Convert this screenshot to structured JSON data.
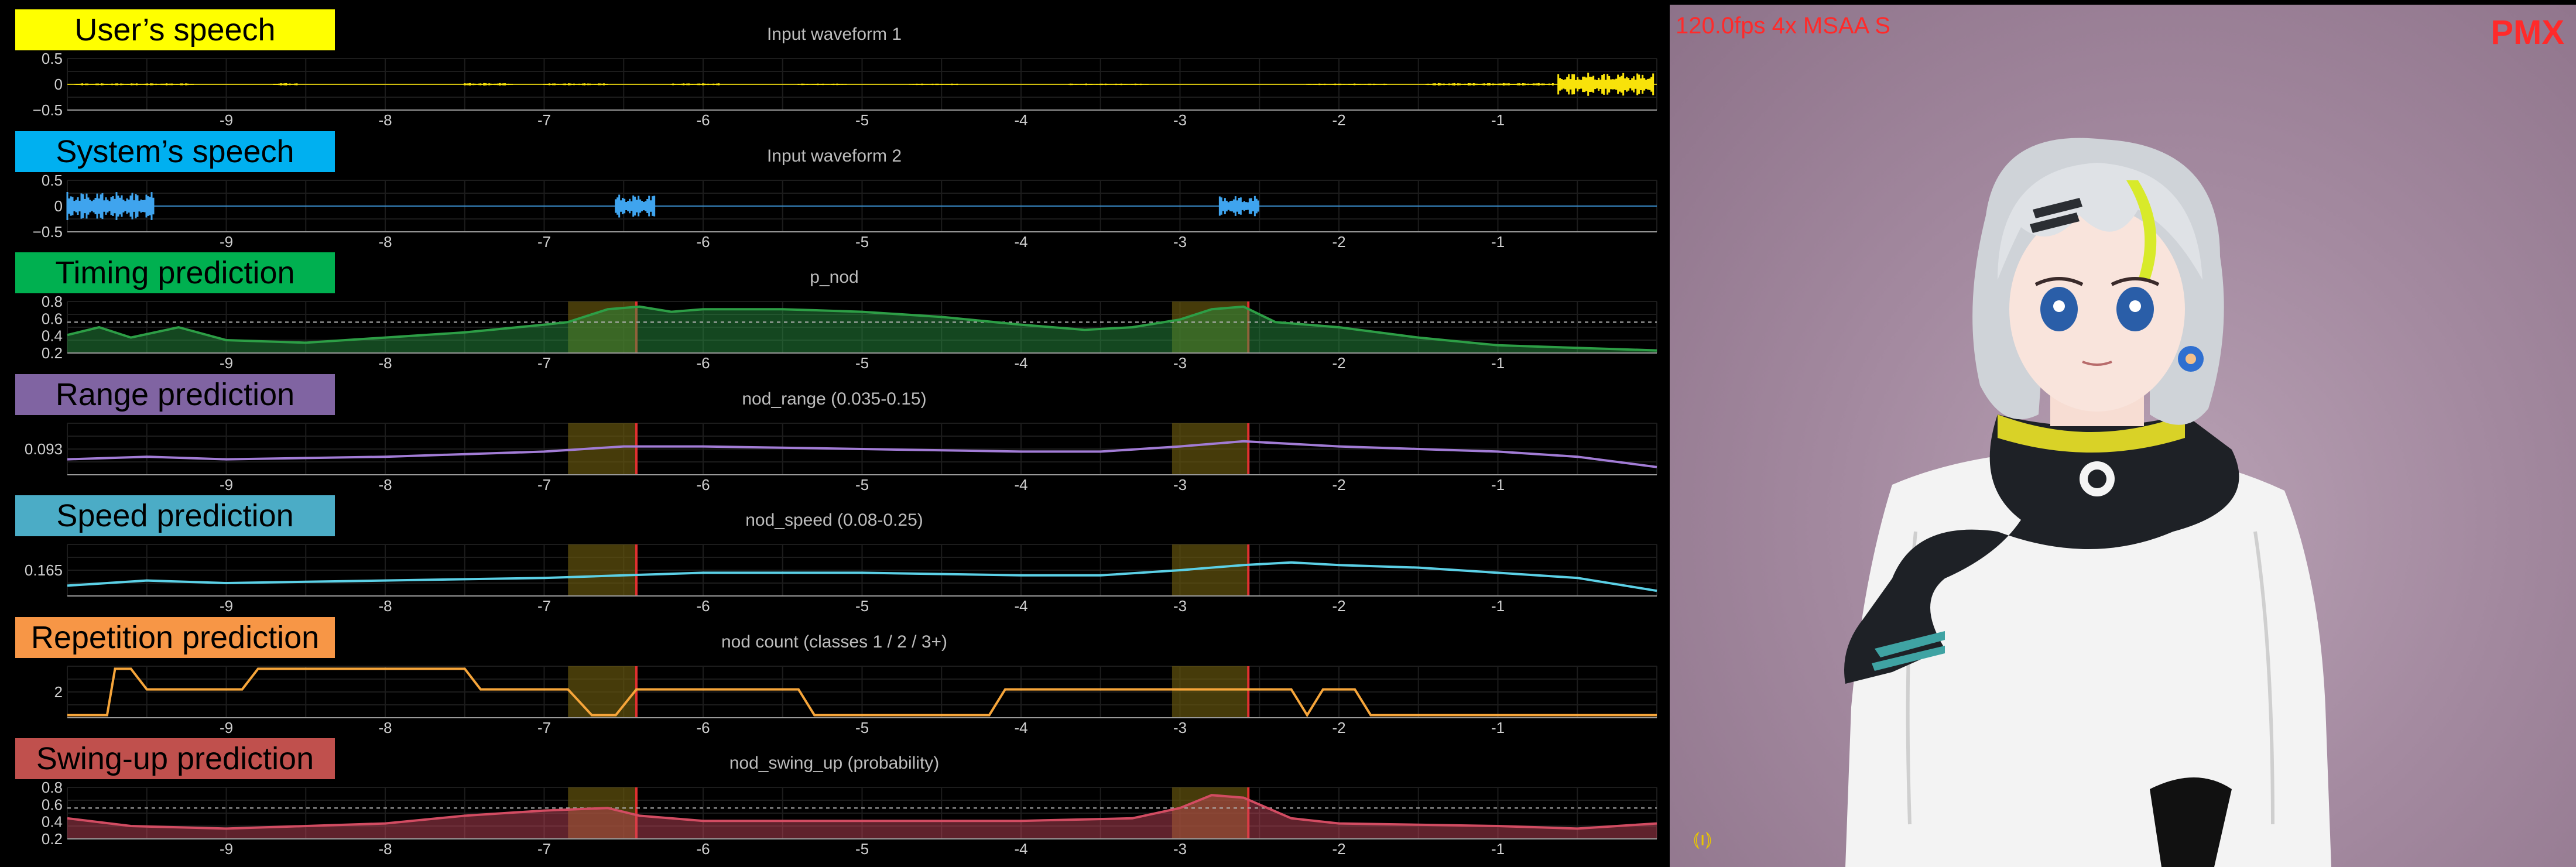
{
  "overlay": {
    "fps_text": "120.0fps 4x MSAA S",
    "mode_text": "PMX",
    "antenna_glyph": "⦅ı⦆"
  },
  "colors": {
    "user": "#f8e20a",
    "system": "#3fa4ee",
    "timing": "#2d9e46",
    "range": "#9a6fc0",
    "speed": "#52c7da",
    "repetition": "#f6a53a",
    "swing": "#d24c62",
    "highlight": "#6b5a10",
    "marker": "#e03030"
  },
  "x_ticks": [
    "-9",
    "-8",
    "-7",
    "-6",
    "-5",
    "-4",
    "-3",
    "-2",
    "-1"
  ],
  "highlight_windows": [
    [
      -6.85,
      -6.42
    ],
    [
      -3.05,
      -2.57
    ]
  ],
  "panels": [
    {
      "id": "user",
      "label": "User’s speech",
      "label_bg": "#ffff00",
      "title": "Input waveform 1",
      "yticks": [
        "0.5",
        "0",
        "−0.5"
      ],
      "kind": "wave",
      "color": "#f8e20a",
      "highlight": false
    },
    {
      "id": "system",
      "label": "System’s speech",
      "label_bg": "#00b0f0",
      "title": "Input waveform 2",
      "yticks": [
        "0.5",
        "0",
        "−0.5"
      ],
      "kind": "wave",
      "color": "#3fa4ee",
      "highlight": false
    },
    {
      "id": "timing",
      "label": "Timing prediction",
      "label_bg": "#00b050",
      "title": "p_nod",
      "yticks": [
        "0.8",
        "0.6",
        "0.4",
        "0.2"
      ],
      "kind": "area",
      "color": "#2d9e46",
      "highlight": true
    },
    {
      "id": "range",
      "label": "Range prediction",
      "label_bg": "#8064a2",
      "title": "nod_range (0.035-0.15)",
      "yticks": [
        "0.093"
      ],
      "kind": "line",
      "color": "#a27cd6",
      "highlight": true
    },
    {
      "id": "speed",
      "label": "Speed prediction",
      "label_bg": "#4bacc6",
      "title": "nod_speed (0.08-0.25)",
      "yticks": [
        "0.165"
      ],
      "kind": "line",
      "color": "#5bd0e6",
      "highlight": true
    },
    {
      "id": "repetition",
      "label": "Repetition prediction",
      "label_bg": "#f79646",
      "title": "nod count (classes 1 / 2 / 3+)",
      "yticks": [
        "2"
      ],
      "kind": "step",
      "color": "#f6a53a",
      "highlight": true
    },
    {
      "id": "swing",
      "label": "Swing-up prediction",
      "label_bg": "#c0504d",
      "title": "nod_swing_up (probability)",
      "yticks": [
        "0.8",
        "0.6",
        "0.4",
        "0.2"
      ],
      "kind": "area",
      "color": "#d24c62",
      "highlight": true
    }
  ],
  "series": {
    "user_bursts": [
      [
        -9.95,
        -9.2,
        0.04
      ],
      [
        -8.7,
        -8.55,
        0.05
      ],
      [
        -7.5,
        -7.2,
        0.05
      ],
      [
        -7.0,
        -6.6,
        0.04
      ],
      [
        -6.2,
        -5.9,
        0.04
      ],
      [
        -5.4,
        -5.1,
        0.03
      ],
      [
        -4.7,
        -4.4,
        0.03
      ],
      [
        -3.7,
        -3.2,
        0.03
      ],
      [
        -2.2,
        -1.7,
        0.03
      ],
      [
        -1.45,
        -0.65,
        0.05
      ],
      [
        -0.62,
        -0.02,
        0.45
      ]
    ],
    "system_bursts": [
      [
        -10.0,
        -9.45,
        0.55
      ],
      [
        -6.55,
        -6.3,
        0.45
      ],
      [
        -2.75,
        -2.5,
        0.4
      ]
    ],
    "timing": [
      [
        -10,
        0.35
      ],
      [
        -9.8,
        0.5
      ],
      [
        -9.6,
        0.3
      ],
      [
        -9.3,
        0.5
      ],
      [
        -9.0,
        0.25
      ],
      [
        -8.5,
        0.2
      ],
      [
        -8.0,
        0.3
      ],
      [
        -7.5,
        0.4
      ],
      [
        -7.0,
        0.55
      ],
      [
        -6.85,
        0.6
      ],
      [
        -6.6,
        0.85
      ],
      [
        -6.4,
        0.9
      ],
      [
        -6.2,
        0.8
      ],
      [
        -6.0,
        0.85
      ],
      [
        -5.5,
        0.85
      ],
      [
        -5.0,
        0.8
      ],
      [
        -4.5,
        0.7
      ],
      [
        -4.0,
        0.55
      ],
      [
        -3.6,
        0.45
      ],
      [
        -3.3,
        0.5
      ],
      [
        -3.0,
        0.65
      ],
      [
        -2.8,
        0.85
      ],
      [
        -2.6,
        0.9
      ],
      [
        -2.4,
        0.6
      ],
      [
        -2.0,
        0.5
      ],
      [
        -1.5,
        0.3
      ],
      [
        -1.0,
        0.15
      ],
      [
        -0.5,
        0.1
      ],
      [
        0,
        0.05
      ]
    ],
    "range": [
      [
        -10,
        0.3
      ],
      [
        -9.5,
        0.35
      ],
      [
        -9.0,
        0.3
      ],
      [
        -8.0,
        0.35
      ],
      [
        -7.0,
        0.45
      ],
      [
        -6.5,
        0.55
      ],
      [
        -6.0,
        0.55
      ],
      [
        -5.0,
        0.5
      ],
      [
        -4.0,
        0.45
      ],
      [
        -3.5,
        0.45
      ],
      [
        -3.0,
        0.55
      ],
      [
        -2.6,
        0.65
      ],
      [
        -2.0,
        0.55
      ],
      [
        -1.5,
        0.5
      ],
      [
        -1.0,
        0.45
      ],
      [
        -0.5,
        0.35
      ],
      [
        0,
        0.15
      ]
    ],
    "speed": [
      [
        -10,
        0.2
      ],
      [
        -9.5,
        0.3
      ],
      [
        -9.0,
        0.25
      ],
      [
        -8.0,
        0.3
      ],
      [
        -7.0,
        0.35
      ],
      [
        -6.5,
        0.4
      ],
      [
        -6.0,
        0.45
      ],
      [
        -5.0,
        0.45
      ],
      [
        -4.0,
        0.4
      ],
      [
        -3.5,
        0.4
      ],
      [
        -3.0,
        0.5
      ],
      [
        -2.6,
        0.6
      ],
      [
        -2.3,
        0.65
      ],
      [
        -2.0,
        0.6
      ],
      [
        -1.5,
        0.55
      ],
      [
        -1.0,
        0.45
      ],
      [
        -0.5,
        0.35
      ],
      [
        0,
        0.1
      ]
    ],
    "repetition": [
      [
        -10,
        0.05
      ],
      [
        -9.75,
        0.05
      ],
      [
        -9.7,
        0.95
      ],
      [
        -9.6,
        0.95
      ],
      [
        -9.5,
        0.55
      ],
      [
        -8.9,
        0.55
      ],
      [
        -8.8,
        0.95
      ],
      [
        -7.5,
        0.95
      ],
      [
        -7.4,
        0.55
      ],
      [
        -6.85,
        0.55
      ],
      [
        -6.7,
        0.05
      ],
      [
        -6.55,
        0.05
      ],
      [
        -6.42,
        0.55
      ],
      [
        -5.4,
        0.55
      ],
      [
        -5.3,
        0.05
      ],
      [
        -4.2,
        0.05
      ],
      [
        -4.1,
        0.55
      ],
      [
        -2.3,
        0.55
      ],
      [
        -2.2,
        0.05
      ],
      [
        -2.1,
        0.55
      ],
      [
        -1.9,
        0.55
      ],
      [
        -1.8,
        0.05
      ],
      [
        0,
        0.05
      ]
    ],
    "swing": [
      [
        -10,
        0.4
      ],
      [
        -9.6,
        0.25
      ],
      [
        -9.0,
        0.2
      ],
      [
        -8.0,
        0.3
      ],
      [
        -7.5,
        0.45
      ],
      [
        -7.0,
        0.55
      ],
      [
        -6.6,
        0.6
      ],
      [
        -6.4,
        0.45
      ],
      [
        -6.0,
        0.35
      ],
      [
        -5.0,
        0.35
      ],
      [
        -4.0,
        0.35
      ],
      [
        -3.3,
        0.4
      ],
      [
        -3.0,
        0.6
      ],
      [
        -2.8,
        0.85
      ],
      [
        -2.6,
        0.8
      ],
      [
        -2.3,
        0.4
      ],
      [
        -2.0,
        0.3
      ],
      [
        -1.0,
        0.25
      ],
      [
        -0.5,
        0.2
      ],
      [
        0,
        0.3
      ]
    ]
  }
}
